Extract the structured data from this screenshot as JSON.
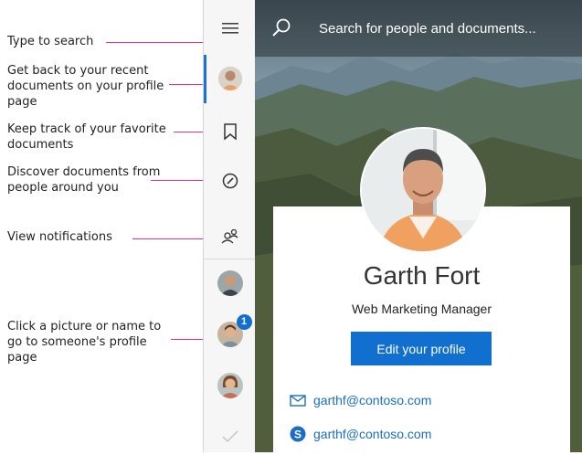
{
  "annotations": {
    "search": "Type to search",
    "profile": "Get back to your recent documents on your profile page",
    "favorites": "Keep track of your favorite documents",
    "discover": "Discover documents from people around you",
    "notifications": "View notifications",
    "people": "Click a picture or name to go to someone's profile page"
  },
  "search": {
    "placeholder": "Search for people and documents..."
  },
  "profile": {
    "name": "Garth Fort",
    "job_title": "Web Marketing Manager",
    "edit_button": "Edit your profile",
    "email": "garthf@contoso.com",
    "skype": "garthf@contoso.com"
  },
  "rail": {
    "notification_badge": "1"
  },
  "colors": {
    "accent": "#1170cf",
    "annotation_line": "#e0338a"
  }
}
